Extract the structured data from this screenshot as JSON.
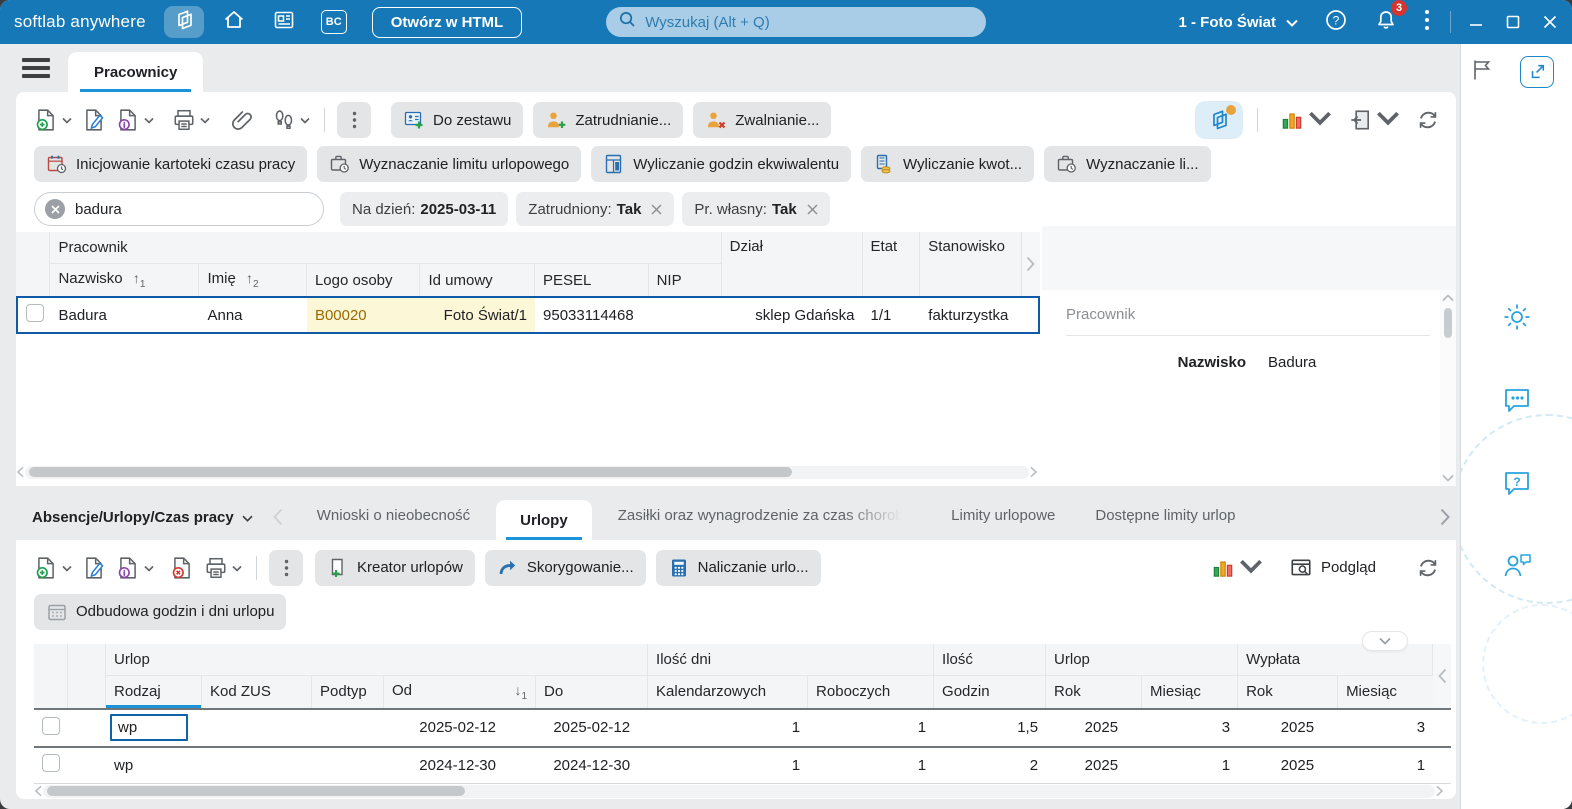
{
  "titlebar": {
    "app_name": "softlab anywhere",
    "bc_label": "BC",
    "open_html_label": "Otwórz w HTML",
    "search_placeholder": "Wyszukaj (Alt + Q)",
    "company_selector": "1 - Foto Świat",
    "notification_count": "3"
  },
  "main_tab": "Pracownicy",
  "toolbar_top": {
    "do_zestawu": "Do zestawu",
    "zatrudnianie": "Zatrudnianie...",
    "zwalnianie": "Zwalnianie..."
  },
  "action_buttons": {
    "inicjowanie": "Inicjowanie kartoteki czasu pracy",
    "wyznaczanie_limitu": "Wyznaczanie limitu urlopowego",
    "wyliczanie_godzin": "Wyliczanie godzin ekwiwalentu",
    "wyliczanie_kwot": "Wyliczanie kwot...",
    "wyznaczanie_li": "Wyznaczanie li..."
  },
  "filters": {
    "search_value": "badura",
    "na_dzien_label": "Na dzień:",
    "na_dzien_value": "2025-03-11",
    "zatrudniony_label": "Zatrudniony:",
    "zatrudniony_value": "Tak",
    "pr_wlasny_label": "Pr. własny:",
    "pr_wlasny_value": "Tak"
  },
  "employees_table": {
    "group_pracownik": "Pracownik",
    "col_nazwisko": "Nazwisko",
    "sort_nazwisko": "1",
    "col_imie": "Imię",
    "sort_imie": "2",
    "col_logo": "Logo osoby",
    "col_id_umowy": "Id umowy",
    "col_pesel": "PESEL",
    "col_nip": "NIP",
    "col_dzial": "Dział",
    "col_etat": "Etat",
    "col_stanowisko": "Stanowisko",
    "row": {
      "nazwisko": "Badura",
      "imie": "Anna",
      "logo": "B00020",
      "id_umowy": "Foto Świat/1",
      "pesel": "95033114468",
      "nip": "",
      "dzial": "sklep Gdańska",
      "etat": "1/1",
      "stanowisko": "fakturzystka"
    }
  },
  "details_panel": {
    "title": "Pracownik",
    "label_nazwisko": "Nazwisko",
    "value_nazwisko": "Badura"
  },
  "bottom_section": {
    "selector_label": "Absencje/Urlopy/Czas pracy",
    "tabs": [
      "Wnioski o nieobecność",
      "Urlopy",
      "Zasiłki oraz wynagrodzenie za czas choroby",
      "Limity urlopowe",
      "Dostępne limity urlop"
    ],
    "active_tab": "Urlopy"
  },
  "toolbar_bottom": {
    "kreator": "Kreator urlopów",
    "skorygowanie": "Skorygowanie...",
    "naliczanie": "Naliczanie urlo...",
    "podglad": "Podgląd",
    "odbudowa": "Odbudowa godzin i dni urlopu"
  },
  "vacations_table": {
    "group_urlop": "Urlop",
    "group_ilosc_dni": "Ilość dni",
    "group_ilosc": "Ilość",
    "group_urlop2": "Urlop",
    "group_wyplata": "Wypłata",
    "col_rodzaj": "Rodzaj",
    "col_kod_zus": "Kod ZUS",
    "col_podtyp": "Podtyp",
    "col_od": "Od",
    "sort_od": "1",
    "col_do": "Do",
    "col_kalendarzowych": "Kalendarzowych",
    "col_roboczych": "Roboczych",
    "col_godzin": "Godzin",
    "col_rok": "Rok",
    "col_miesiac": "Miesiąc",
    "col_rok2": "Rok",
    "col_miesiac2": "Miesiąc",
    "rows": [
      {
        "rodzaj": "wp",
        "kod_zus": "",
        "podtyp": "",
        "od": "2025-02-12",
        "do": "2025-02-12",
        "kalendarzowych": "1",
        "roboczych": "1",
        "godzin": "1,5",
        "urlop_rok": "2025",
        "urlop_miesiac": "3",
        "wyplata_rok": "2025",
        "wyplata_miesiac": "3"
      },
      {
        "rodzaj": "wp",
        "kod_zus": "",
        "podtyp": "",
        "od": "2024-12-30",
        "do": "2024-12-30",
        "kalendarzowych": "1",
        "roboczych": "1",
        "godzin": "2",
        "urlop_rok": "2025",
        "urlop_miesiac": "1",
        "wyplata_rok": "2025",
        "wyplata_miesiac": "1"
      }
    ]
  },
  "colors": {
    "titlebar": "#1678b6",
    "accent": "#1b93d8",
    "selection_border": "#0e5aa7",
    "highlight_bg": "#fcf8d7",
    "highlight_text": "#9a6a00",
    "badge": "#d6352f"
  }
}
